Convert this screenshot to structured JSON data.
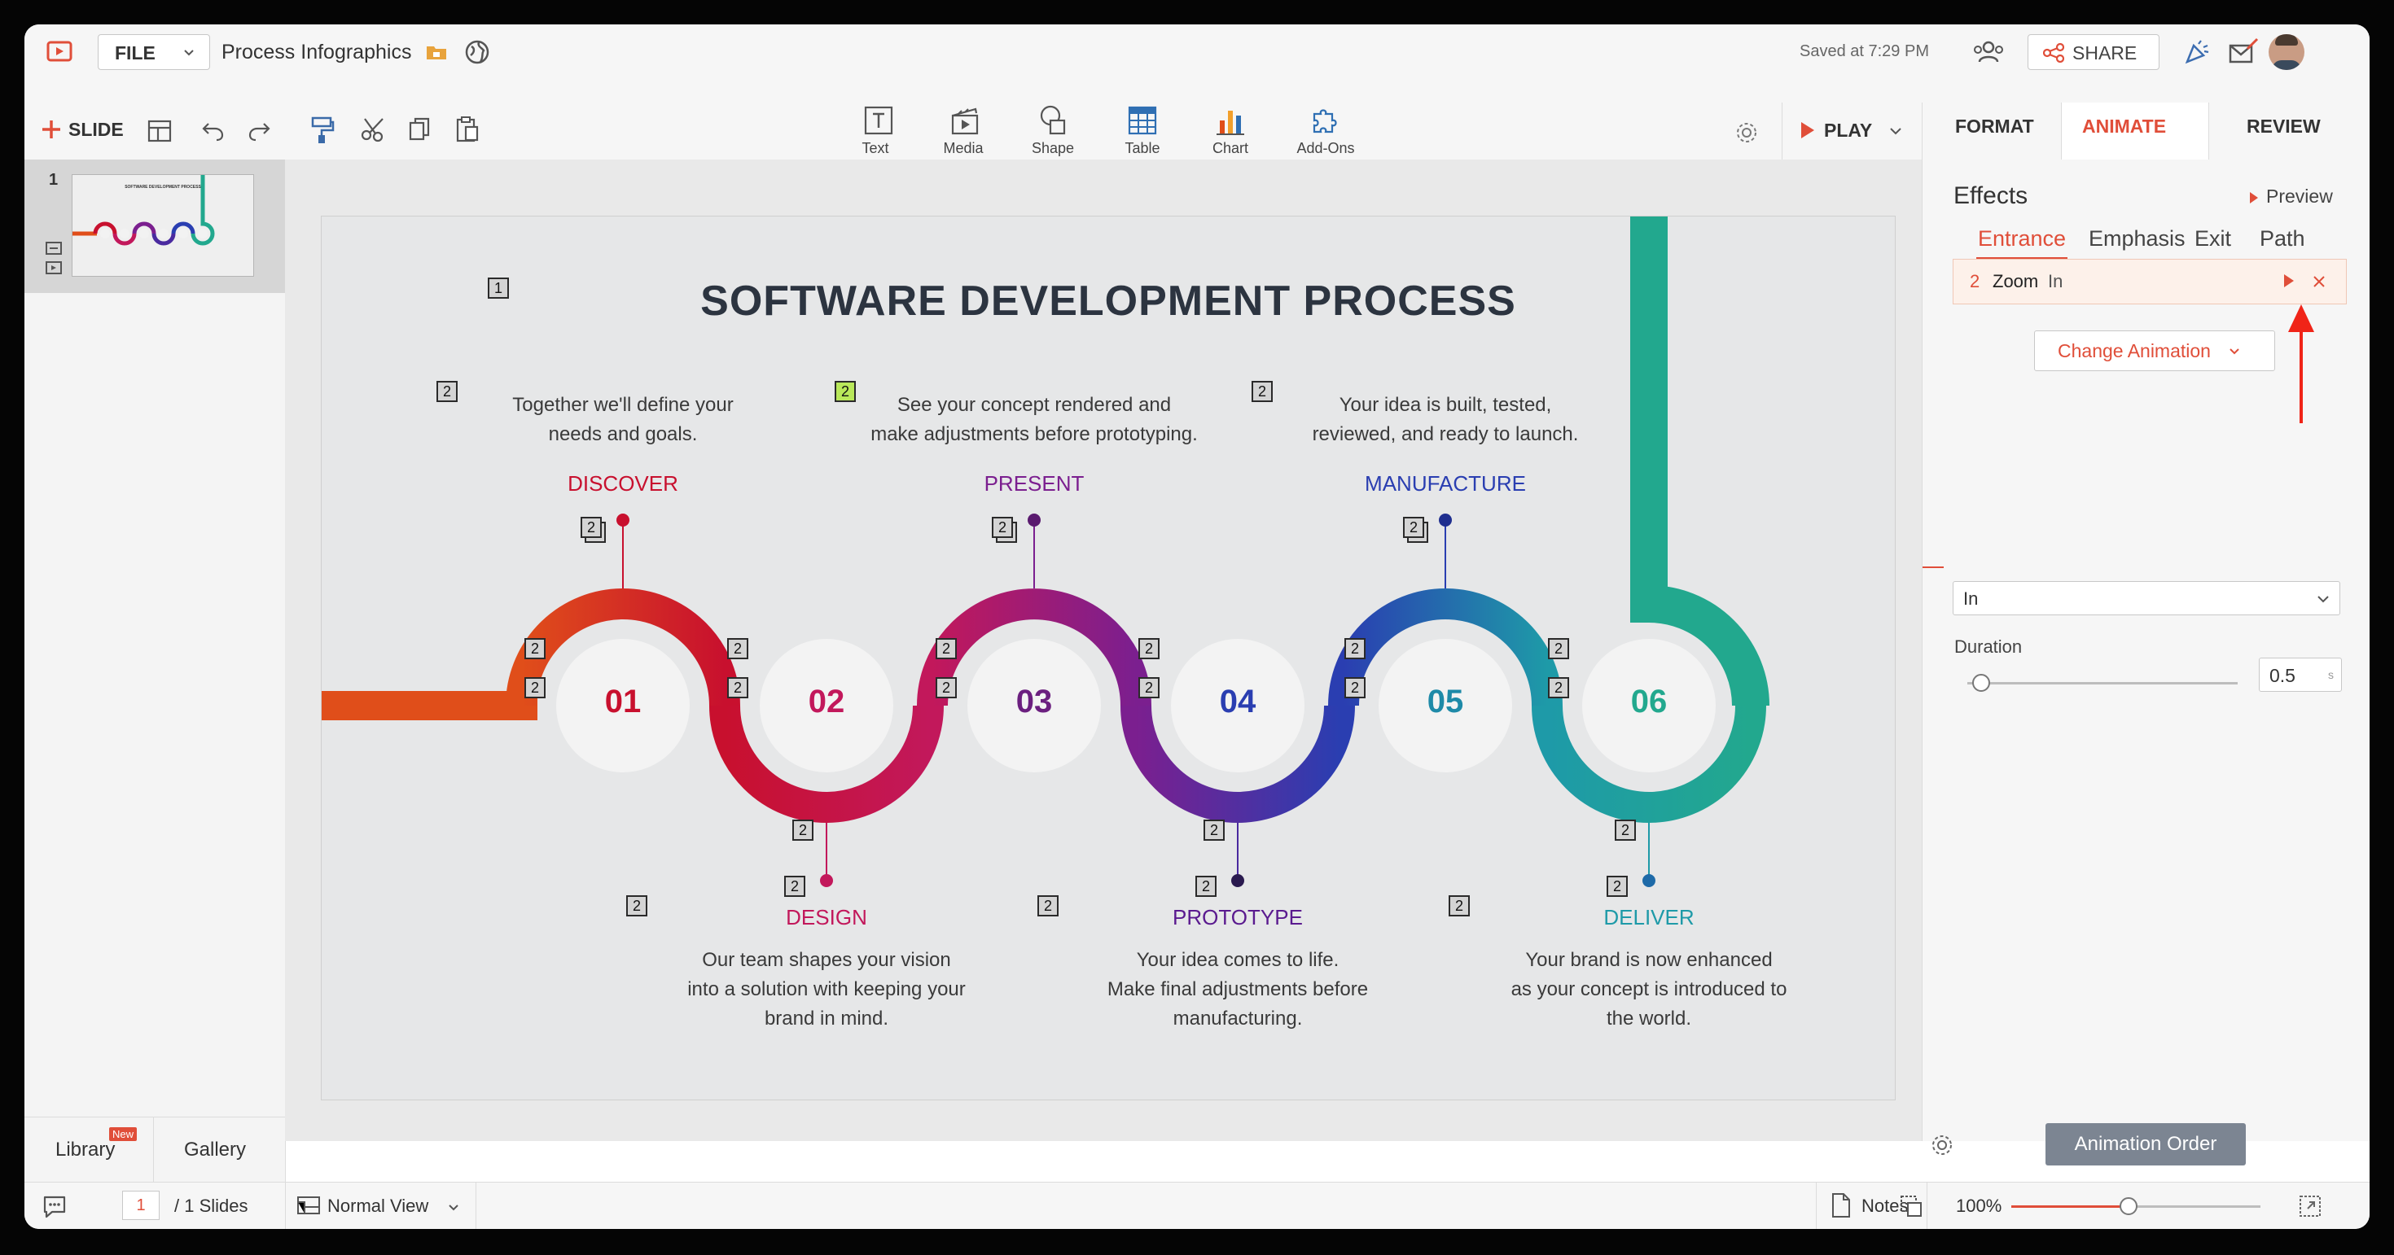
{
  "header": {
    "file_label": "FILE",
    "doc_title": "Process Infographics",
    "saved_status": "Saved at 7:29 PM",
    "share_label": "SHARE"
  },
  "toolbar": {
    "slide_label": "SLIDE",
    "insert_items": [
      {
        "label": "Text",
        "icon": "text-box-icon"
      },
      {
        "label": "Media",
        "icon": "media-icon"
      },
      {
        "label": "Shape",
        "icon": "shape-icon"
      },
      {
        "label": "Table",
        "icon": "table-icon"
      },
      {
        "label": "Chart",
        "icon": "chart-icon"
      },
      {
        "label": "Add-Ons",
        "icon": "puzzle-icon"
      }
    ],
    "play_label": "PLAY"
  },
  "right_tabs": [
    {
      "label": "FORMAT",
      "active": false
    },
    {
      "label": "ANIMATE",
      "active": true
    },
    {
      "label": "REVIEW",
      "active": false
    }
  ],
  "slides_panel": {
    "slide_number": "1",
    "thumbnail_title": "SOFTWARE DEVELOPMENT PROCESS",
    "library_label": "Library",
    "library_badge": "New",
    "gallery_label": "Gallery"
  },
  "slide": {
    "title": "SOFTWARE DEVELOPMENT PROCESS",
    "title_badge": "1",
    "steps": [
      {
        "num": "01",
        "stage": "DISCOVER",
        "desc1": "Together we'll define your",
        "desc2": "needs and goals.",
        "desc3": "",
        "color": "#c8102e"
      },
      {
        "num": "02",
        "stage": "DESIGN",
        "desc1": "Our team shapes your vision",
        "desc2": "into a solution with keeping your",
        "desc3": "brand in mind.",
        "color": "#c2185b"
      },
      {
        "num": "03",
        "stage": "PRESENT",
        "desc1": "See your concept rendered and",
        "desc2": "make adjustments before prototyping.",
        "desc3": "",
        "color": "#7b1f8f"
      },
      {
        "num": "04",
        "stage": "PROTOTYPE",
        "desc1": "Your idea comes to life.",
        "desc2": "Make final adjustments before",
        "desc3": "manufacturing.",
        "color": "#5a1a8f"
      },
      {
        "num": "05",
        "stage": "MANUFACTURE",
        "desc1": "Your idea is built, tested,",
        "desc2": "reviewed, and ready to launch.",
        "desc3": "",
        "color": "#2a3eb1"
      },
      {
        "num": "06",
        "stage": "DELIVER",
        "desc1": "Your brand is now enhanced",
        "desc2": "as your concept is introduced to",
        "desc3": "the world.",
        "color": "#1e9aa8"
      }
    ],
    "anim_badge": "2"
  },
  "animate_panel": {
    "effects_label": "Effects",
    "preview_label": "Preview",
    "effect_tabs": [
      {
        "label": "Entrance",
        "active": true
      },
      {
        "label": "Emphasis",
        "active": false
      },
      {
        "label": "Exit",
        "active": false
      },
      {
        "label": "Path",
        "active": false
      }
    ],
    "animation": {
      "order": "2",
      "name": "Zoom",
      "direction": "In"
    },
    "change_label": "Change Animation",
    "direction_value": "In",
    "duration_label": "Duration",
    "duration_value": "0.5",
    "duration_unit": "s",
    "duration_slider": 0.05,
    "order_button": "Animation Order"
  },
  "statusbar": {
    "current_slide": "1",
    "total_slides": "/ 1 Slides",
    "view_label": "Normal View",
    "notes_label": "Notes",
    "zoom": "100%",
    "zoom_slider": 0.47
  },
  "colors": {
    "accent": "#e04e39",
    "teal": "#22a88e",
    "orange": "#e04e1a"
  }
}
